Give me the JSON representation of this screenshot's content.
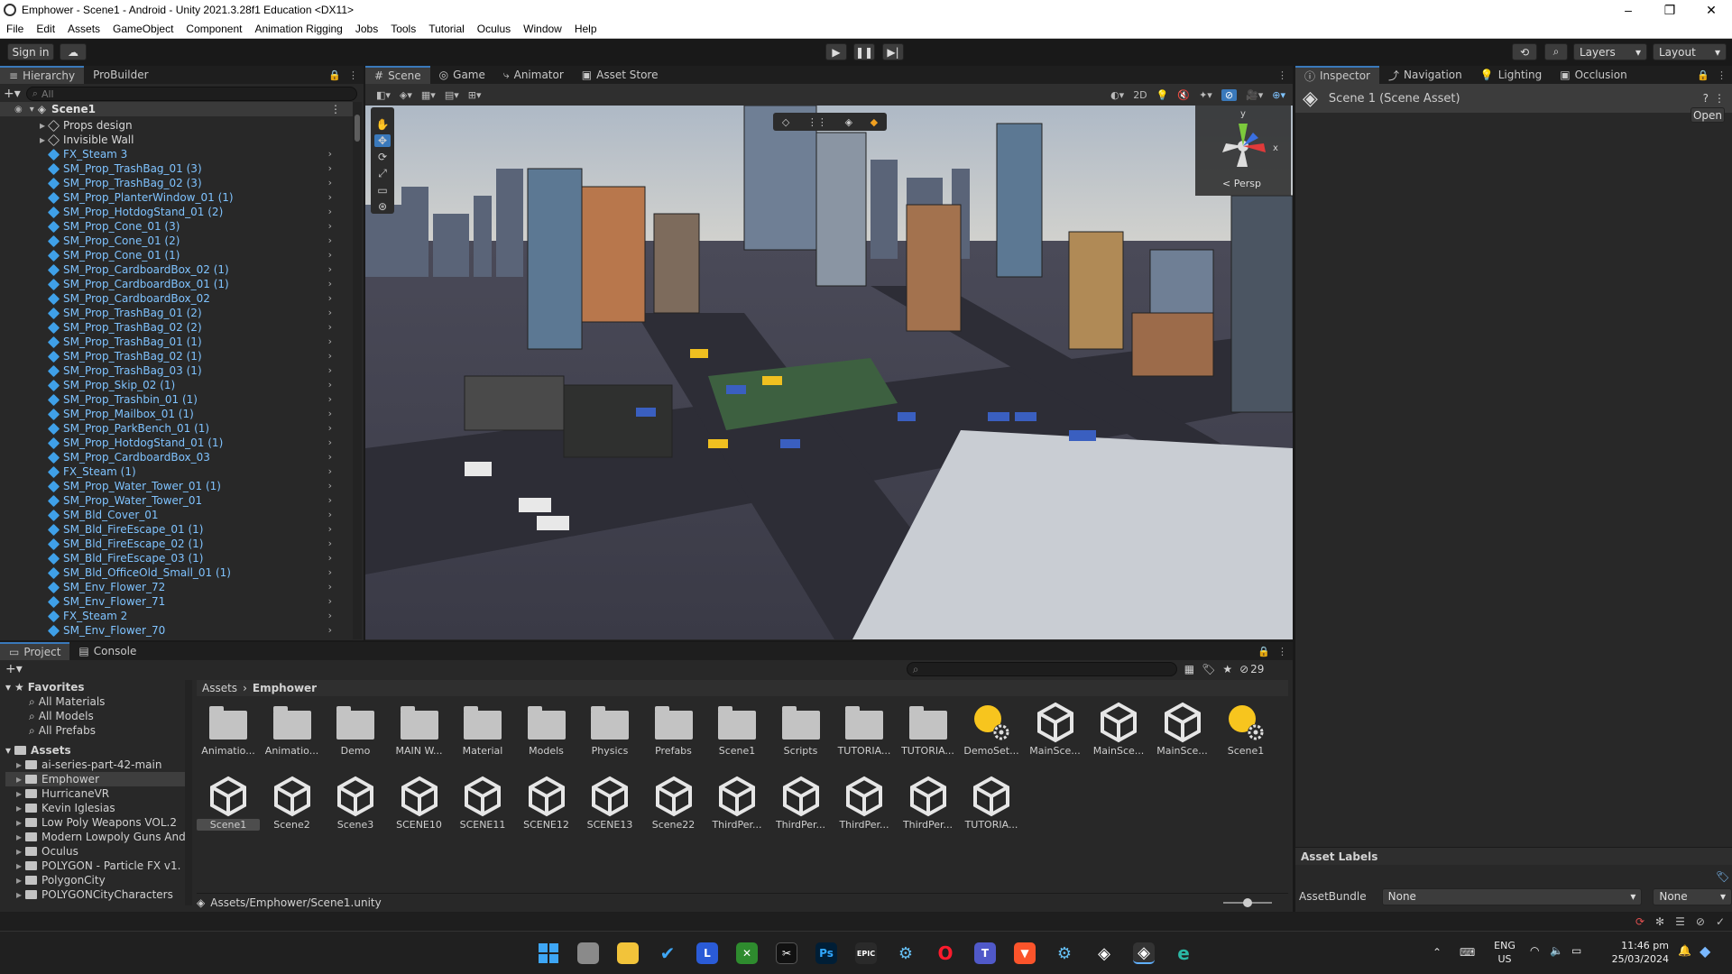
{
  "window": {
    "title": "Emphower - Scene1 - Android - Unity 2021.3.28f1 Education <DX11>",
    "controls": [
      "–",
      "❐",
      "✕"
    ]
  },
  "menu": [
    "File",
    "Edit",
    "Assets",
    "GameObject",
    "Component",
    "Animation Rigging",
    "Jobs",
    "Tools",
    "Tutorial",
    "Oculus",
    "Window",
    "Help"
  ],
  "toolbar": {
    "sign_in": "Sign in",
    "layers": "Layers",
    "layout": "Layout"
  },
  "hierarchy": {
    "tabs": [
      "Hierarchy",
      "ProBuilder"
    ],
    "search_placeholder": "All",
    "scene": "Scene1",
    "items": [
      {
        "name": "Props design",
        "type": "group"
      },
      {
        "name": "Invisible Wall",
        "type": "group"
      },
      {
        "name": "FX_Steam 3",
        "type": "prefab"
      },
      {
        "name": "SM_Prop_TrashBag_01 (3)",
        "type": "prefab"
      },
      {
        "name": "SM_Prop_TrashBag_02 (3)",
        "type": "prefab"
      },
      {
        "name": "SM_Prop_PlanterWindow_01 (1)",
        "type": "prefab"
      },
      {
        "name": "SM_Prop_HotdogStand_01 (2)",
        "type": "prefab"
      },
      {
        "name": "SM_Prop_Cone_01 (3)",
        "type": "prefab"
      },
      {
        "name": "SM_Prop_Cone_01 (2)",
        "type": "prefab"
      },
      {
        "name": "SM_Prop_Cone_01 (1)",
        "type": "prefab"
      },
      {
        "name": "SM_Prop_CardboardBox_02 (1)",
        "type": "prefab"
      },
      {
        "name": "SM_Prop_CardboardBox_01 (1)",
        "type": "prefab"
      },
      {
        "name": "SM_Prop_CardboardBox_02",
        "type": "prefab"
      },
      {
        "name": "SM_Prop_TrashBag_01 (2)",
        "type": "prefab"
      },
      {
        "name": "SM_Prop_TrashBag_02 (2)",
        "type": "prefab"
      },
      {
        "name": "SM_Prop_TrashBag_01 (1)",
        "type": "prefab"
      },
      {
        "name": "SM_Prop_TrashBag_02 (1)",
        "type": "prefab"
      },
      {
        "name": "SM_Prop_TrashBag_03 (1)",
        "type": "prefab"
      },
      {
        "name": "SM_Prop_Skip_02 (1)",
        "type": "prefab"
      },
      {
        "name": "SM_Prop_Trashbin_01 (1)",
        "type": "prefab"
      },
      {
        "name": "SM_Prop_Mailbox_01 (1)",
        "type": "prefab"
      },
      {
        "name": "SM_Prop_ParkBench_01 (1)",
        "type": "prefab"
      },
      {
        "name": "SM_Prop_HotdogStand_01 (1)",
        "type": "prefab"
      },
      {
        "name": "SM_Prop_CardboardBox_03",
        "type": "prefab"
      },
      {
        "name": "FX_Steam (1)",
        "type": "prefab"
      },
      {
        "name": "SM_Prop_Water_Tower_01 (1)",
        "type": "prefab"
      },
      {
        "name": "SM_Prop_Water_Tower_01",
        "type": "prefab"
      },
      {
        "name": "SM_Bld_Cover_01",
        "type": "prefab"
      },
      {
        "name": "SM_Bld_FireEscape_01 (1)",
        "type": "prefab"
      },
      {
        "name": "SM_Bld_FireEscape_02 (1)",
        "type": "prefab"
      },
      {
        "name": "SM_Bld_FireEscape_03 (1)",
        "type": "prefab"
      },
      {
        "name": "SM_Bld_OfficeOld_Small_01 (1)",
        "type": "prefab"
      },
      {
        "name": "SM_Env_Flower_72",
        "type": "prefab"
      },
      {
        "name": "SM_Env_Flower_71",
        "type": "prefab"
      },
      {
        "name": "FX_Steam 2",
        "type": "prefab"
      },
      {
        "name": "SM_Env_Flower_70",
        "type": "prefab"
      }
    ]
  },
  "scene_tabs": [
    "Scene",
    "Game",
    "Animator",
    "Asset Store"
  ],
  "scene_toolbar": {
    "mode_2d": "2D"
  },
  "gizmo": {
    "label": "< Persp",
    "y": "y",
    "x": "x"
  },
  "inspector": {
    "tabs": [
      "Inspector",
      "Navigation",
      "Lighting",
      "Occlusion"
    ],
    "asset_title": "Scene 1 (Scene Asset)",
    "open_button": "Open",
    "asset_labels": "Asset Labels",
    "assetbundle_label": "AssetBundle",
    "assetbundle_value": "None",
    "variant_value": "None"
  },
  "project": {
    "tabs": [
      "Project",
      "Console"
    ],
    "hidden_count": "29",
    "breadcrumb": [
      "Assets",
      "Emphower"
    ],
    "favorites_label": "Favorites",
    "favorites": [
      "All Materials",
      "All Models",
      "All Prefabs"
    ],
    "assets_label": "Assets",
    "tree": [
      "ai-series-part-42-main",
      "Emphower",
      "HurricaneVR",
      "Kevin Iglesias",
      "Low Poly Weapons VOL.2",
      "Modern Lowpoly Guns And",
      "Oculus",
      "POLYGON - Particle FX v1.",
      "PolygonCity",
      "POLYGONCityCharacters"
    ],
    "grid_row1": [
      {
        "label": "Animatio...",
        "kind": "folder"
      },
      {
        "label": "Animatio...",
        "kind": "folder"
      },
      {
        "label": "Demo",
        "kind": "folder"
      },
      {
        "label": "MAIN W...",
        "kind": "folder"
      },
      {
        "label": "Material",
        "kind": "folder"
      },
      {
        "label": "Models",
        "kind": "folder"
      },
      {
        "label": "Physics",
        "kind": "folder"
      },
      {
        "label": "Prefabs",
        "kind": "folder"
      },
      {
        "label": "Scene1",
        "kind": "folder"
      },
      {
        "label": "Scripts",
        "kind": "folder"
      },
      {
        "label": "TUTORIA...",
        "kind": "folder"
      },
      {
        "label": "TUTORIA...",
        "kind": "folder"
      },
      {
        "label": "DemoSet...",
        "kind": "lighting"
      },
      {
        "label": "MainSce...",
        "kind": "scene"
      },
      {
        "label": "MainSce...",
        "kind": "scene"
      },
      {
        "label": "MainSce...",
        "kind": "scene"
      },
      {
        "label": "Scene1",
        "kind": "lighting"
      }
    ],
    "grid_row2": [
      {
        "label": "Scene1",
        "kind": "scene"
      },
      {
        "label": "Scene2",
        "kind": "scene"
      },
      {
        "label": "Scene3",
        "kind": "scene"
      },
      {
        "label": "SCENE10",
        "kind": "scene"
      },
      {
        "label": "SCENE11",
        "kind": "scene"
      },
      {
        "label": "SCENE12",
        "kind": "scene"
      },
      {
        "label": "SCENE13",
        "kind": "scene"
      },
      {
        "label": "Scene22",
        "kind": "scene"
      },
      {
        "label": "ThirdPer...",
        "kind": "scene"
      },
      {
        "label": "ThirdPer...",
        "kind": "scene"
      },
      {
        "label": "ThirdPer...",
        "kind": "scene"
      },
      {
        "label": "ThirdPer...",
        "kind": "scene"
      },
      {
        "label": "TUTORIA...",
        "kind": "scene"
      }
    ],
    "path": "Assets/Emphower/Scene1.unity"
  },
  "taskbar": {
    "lang": "ENG",
    "region": "US",
    "time": "11:46 pm",
    "date": "25/03/2024",
    "apps": [
      "windows-start",
      "file-manager",
      "folder",
      "todo",
      "L",
      "xbox",
      "capcut",
      "Ps",
      "EPIC",
      "steam",
      "opera",
      "teams",
      "brave",
      "steam-vr",
      "unity-hub",
      "unity",
      "edge"
    ]
  },
  "colors": {
    "accent": "#3a79bb",
    "prefab_blue": "#7fc3ff",
    "panel_bg": "#282828",
    "lighting_yellow": "#f7c51e"
  }
}
